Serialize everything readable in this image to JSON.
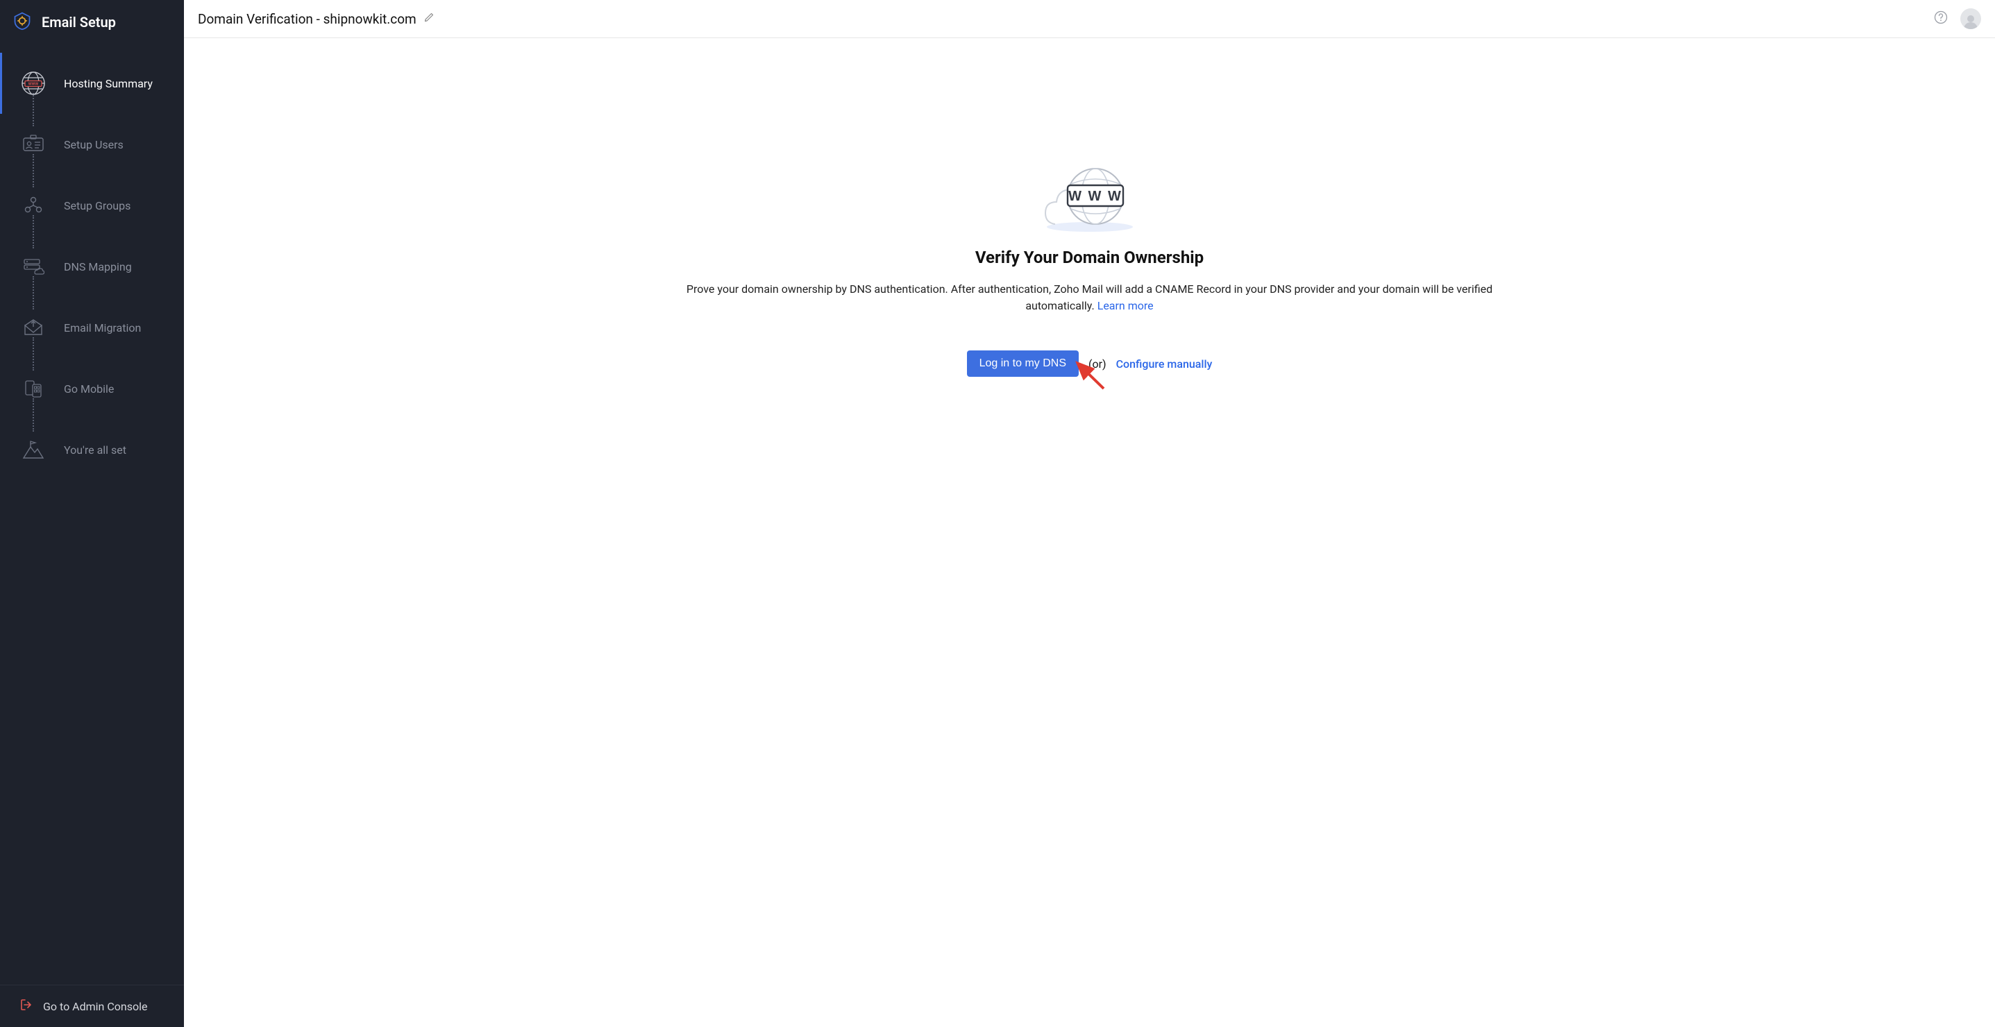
{
  "sidebar": {
    "title": "Email Setup",
    "items": [
      {
        "label": "Hosting Summary"
      },
      {
        "label": "Setup Users"
      },
      {
        "label": "Setup Groups"
      },
      {
        "label": "DNS Mapping"
      },
      {
        "label": "Email Migration"
      },
      {
        "label": "Go Mobile"
      },
      {
        "label": "You're all set"
      }
    ],
    "footer_label": "Go to Admin Console"
  },
  "header": {
    "title": "Domain Verification - shipnowkit.com"
  },
  "main": {
    "heading": "Verify Your Domain Ownership",
    "description": "Prove your domain ownership by DNS authentication. After authentication, Zoho Mail will add a CNAME Record in your DNS provider and your domain will be verified automatically.",
    "learn_more": "Learn more",
    "primary_button": "Log in to my DNS",
    "or_text": "(or)",
    "manual_link": "Configure manually"
  }
}
